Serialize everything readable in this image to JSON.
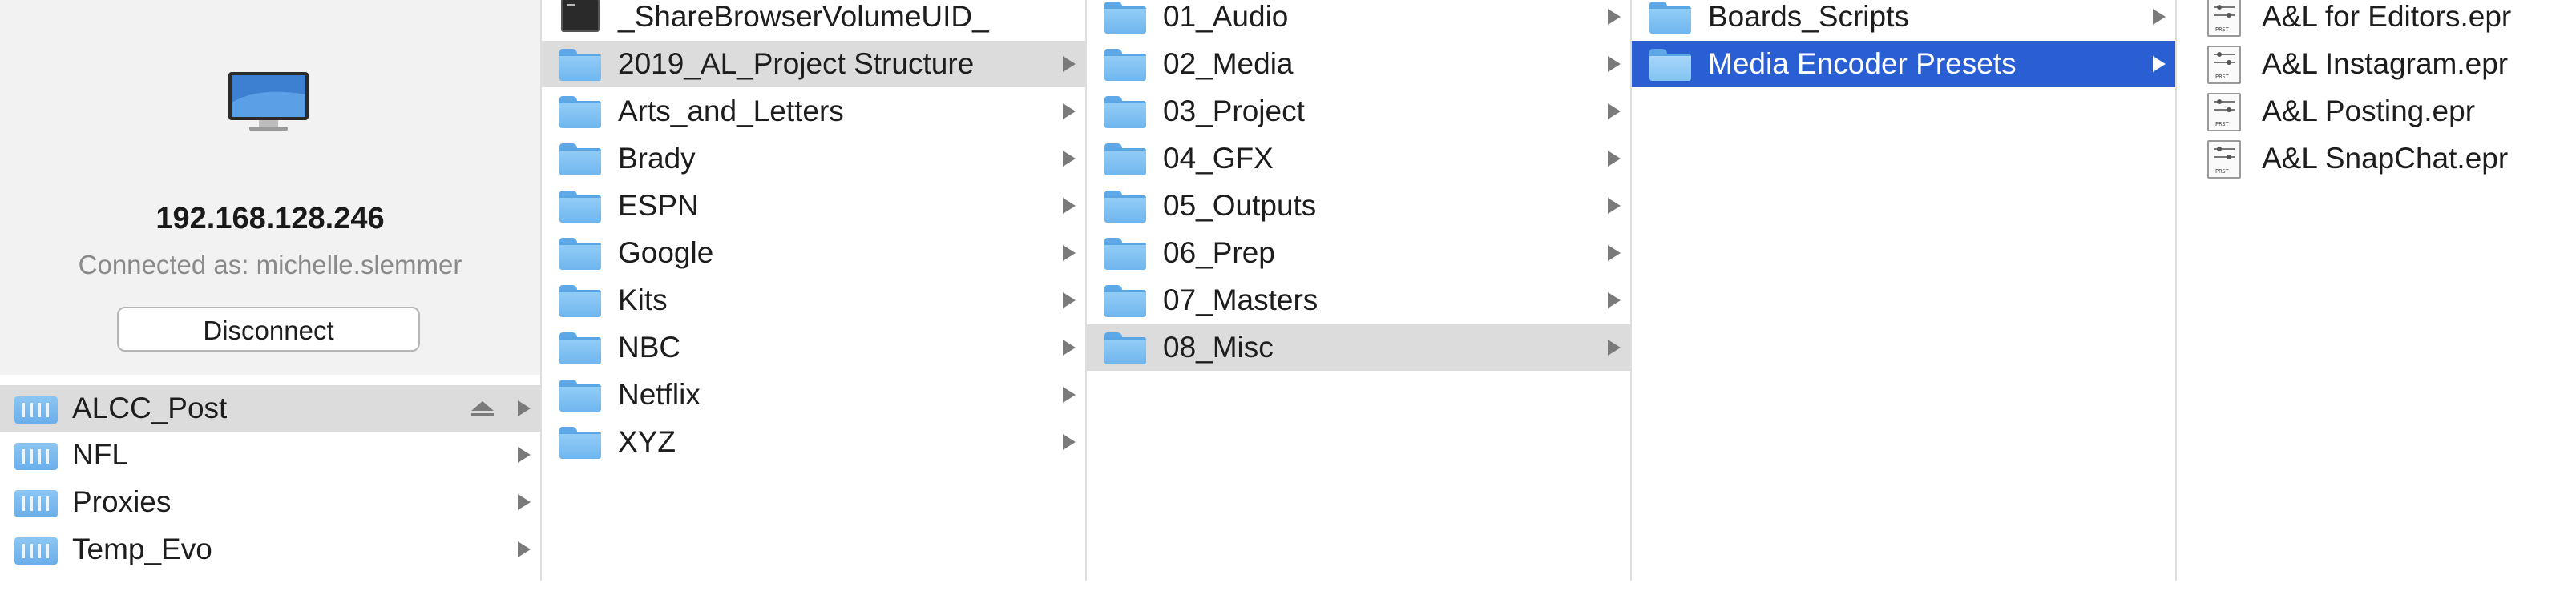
{
  "server": {
    "ip": "192.168.128.246",
    "connected_as": "Connected as: michelle.slemmer",
    "disconnect_label": "Disconnect"
  },
  "volumes": [
    {
      "label": "ALCC_Post",
      "selected": true
    },
    {
      "label": "NFL"
    },
    {
      "label": "Proxies"
    },
    {
      "label": "Temp_Evo"
    }
  ],
  "column1": [
    {
      "label": "_ShareBrowserVolumeUID_",
      "type": "file"
    },
    {
      "label": "2019_AL_Project Structure",
      "type": "folder",
      "selected": true
    },
    {
      "label": "Arts_and_Letters",
      "type": "folder"
    },
    {
      "label": "Brady",
      "type": "folder"
    },
    {
      "label": "ESPN",
      "type": "folder"
    },
    {
      "label": "Google",
      "type": "folder"
    },
    {
      "label": "Kits",
      "type": "folder"
    },
    {
      "label": "NBC",
      "type": "folder"
    },
    {
      "label": "Netflix",
      "type": "folder"
    },
    {
      "label": "XYZ",
      "type": "folder"
    }
  ],
  "column2": [
    {
      "label": "01_Audio"
    },
    {
      "label": "02_Media"
    },
    {
      "label": "03_Project"
    },
    {
      "label": "04_GFX"
    },
    {
      "label": "05_Outputs"
    },
    {
      "label": "06_Prep"
    },
    {
      "label": "07_Masters"
    },
    {
      "label": "08_Misc",
      "selected": true
    }
  ],
  "column3": [
    {
      "label": "Boards_Scripts"
    },
    {
      "label": "Media Encoder Presets",
      "selected": true
    }
  ],
  "column4": [
    {
      "label": "A&L for Editors.epr"
    },
    {
      "label": "A&L Instagram.epr"
    },
    {
      "label": "A&L Posting.epr"
    },
    {
      "label": "A&L SnapChat.epr"
    }
  ],
  "icons": {
    "preset_text": "PRST"
  },
  "colors": {
    "selection_blue": "#2a5fd4",
    "selection_grey": "#dcdcdc",
    "folder_blue": "#7dbcf0"
  }
}
